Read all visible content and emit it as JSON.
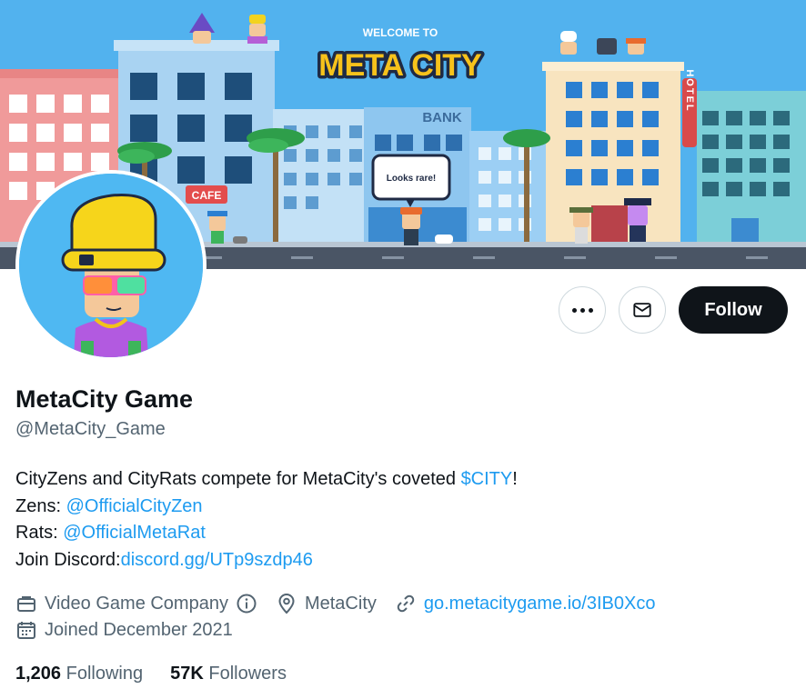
{
  "banner": {
    "welcome_text": "WELCOME TO",
    "title": "META CITY",
    "bank_sign": "BANK",
    "cafe_sign": "CAFE",
    "hotel_sign": "HOTEL",
    "speech_bubble": "Looks rare!"
  },
  "actions": {
    "follow_label": "Follow"
  },
  "profile": {
    "name": "MetaCity Game",
    "handle": "@MetaCity_Game",
    "bio": {
      "line1_text": "CityZens and CityRats compete for MetaCity's coveted ",
      "line1_link": "$CITY",
      "line1_end": "!",
      "line2_prefix": "Zens: ",
      "line2_link": "@OfficialCityZen",
      "line3_prefix": "Rats: ",
      "line3_link": "@OfficialMetaRat",
      "line4_prefix": "Join Discord:",
      "line4_link": "discord.gg/UTp9szdp46"
    },
    "category": "Video Game Company",
    "location": "MetaCity",
    "website": "go.metacitygame.io/3IB0Xco",
    "joined": "Joined December 2021",
    "following_count": "1,206",
    "following_label": "Following",
    "followers_count": "57K",
    "followers_label": "Followers"
  },
  "colors": {
    "accent": "#1d9bf0",
    "text_primary": "#0f1419",
    "text_secondary": "#536471",
    "follow_bg": "#0f1419",
    "banner_sky": "#5ab4ef"
  },
  "icons": [
    "more-icon",
    "mail-icon",
    "briefcase-icon",
    "info-icon",
    "location-icon",
    "link-icon",
    "calendar-icon"
  ]
}
